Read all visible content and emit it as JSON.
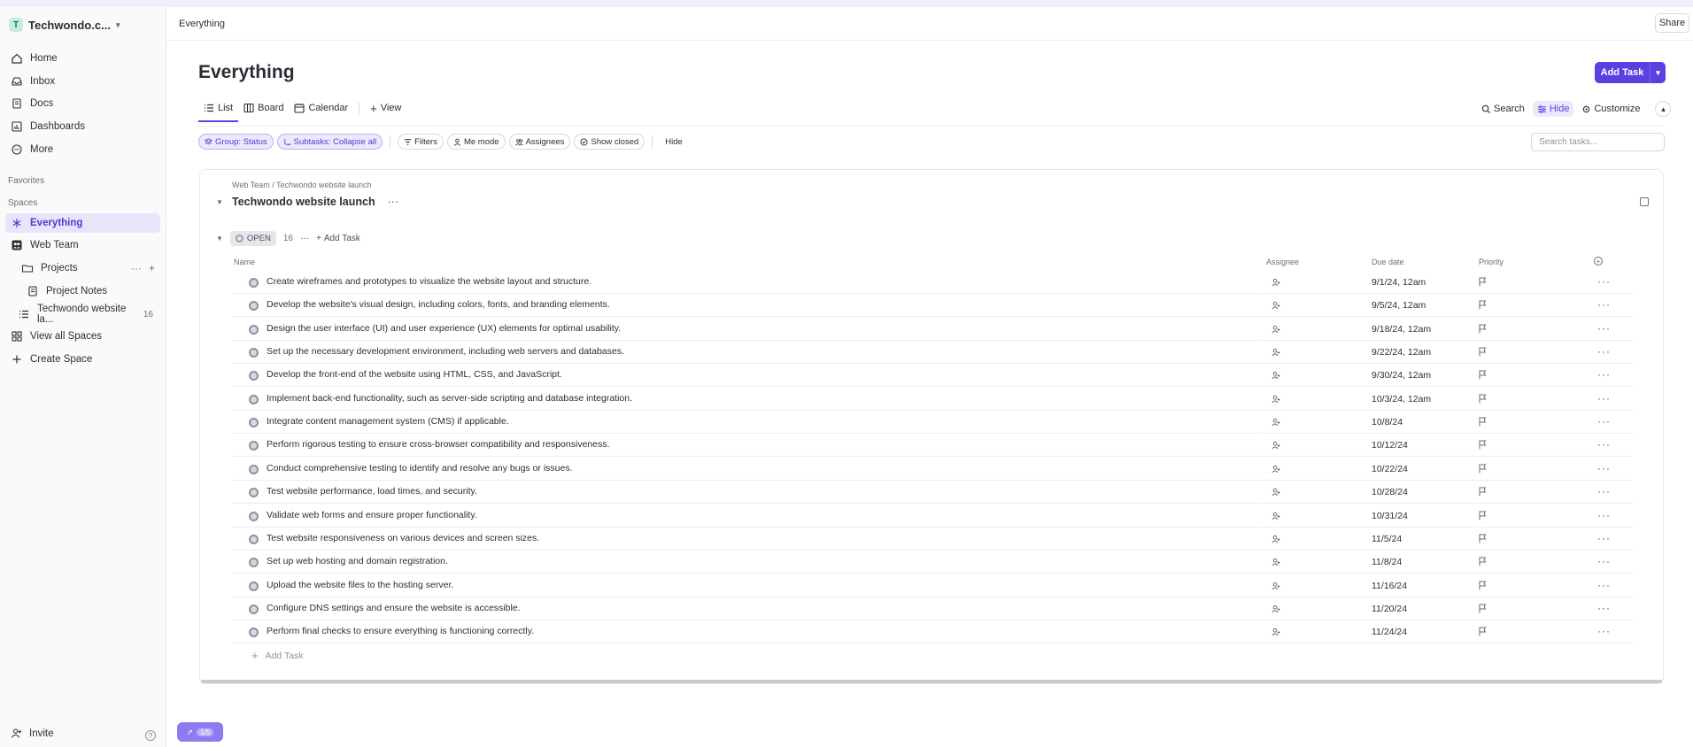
{
  "workspace": {
    "avatar_letter": "T",
    "name": "Techwondo.c..."
  },
  "nav": {
    "home": "Home",
    "inbox": "Inbox",
    "docs": "Docs",
    "dashboards": "Dashboards",
    "more": "More"
  },
  "sidebar": {
    "favorites_label": "Favorites",
    "spaces_label": "Spaces",
    "everything": "Everything",
    "web_team": "Web Team",
    "projects": "Projects",
    "project_notes": "Project Notes",
    "list_name": "Techwondo website la...",
    "list_count": "16",
    "view_all_spaces": "View all Spaces",
    "create_space": "Create Space",
    "invite": "Invite"
  },
  "header": {
    "breadcrumb": "Everything",
    "share_label": "Share",
    "page_title": "Everything",
    "add_task_label": "Add Task"
  },
  "tabs": {
    "list": "List",
    "board": "Board",
    "calendar": "Calendar",
    "add_view": "View"
  },
  "tools": {
    "search": "Search",
    "hide": "Hide",
    "customize": "Customize"
  },
  "chips": {
    "group_status": "Group: Status",
    "subtasks": "Subtasks: Collapse all",
    "filters": "Filters",
    "me_mode": "Me mode",
    "assignees": "Assignees",
    "show_closed": "Show closed",
    "hide": "Hide"
  },
  "search_tasks_placeholder": "Search tasks...",
  "list": {
    "breadcrumb": "Web Team / Techwondo website launch",
    "title": "Techwondo website launch",
    "group": {
      "status": "OPEN",
      "count": "16",
      "add_task": "Add Task"
    },
    "columns": {
      "name": "Name",
      "assignee": "Assignee",
      "due_date": "Due date",
      "priority": "Priority"
    },
    "tasks": [
      {
        "name": "Create wireframes and prototypes to visualize the website layout and structure.",
        "due": "9/1/24, 12am"
      },
      {
        "name": "Develop the website's visual design, including colors, fonts, and branding elements.",
        "due": "9/5/24, 12am"
      },
      {
        "name": "Design the user interface (UI) and user experience (UX) elements for optimal usability.",
        "due": "9/18/24, 12am"
      },
      {
        "name": "Set up the necessary development environment, including web servers and databases.",
        "due": "9/22/24, 12am"
      },
      {
        "name": "Develop the front-end of the website using HTML, CSS, and JavaScript.",
        "due": "9/30/24, 12am"
      },
      {
        "name": "Implement back-end functionality, such as server-side scripting and database integration.",
        "due": "10/3/24, 12am"
      },
      {
        "name": "Integrate content management system (CMS) if applicable.",
        "due": "10/8/24"
      },
      {
        "name": "Perform rigorous testing to ensure cross-browser compatibility and responsiveness.",
        "due": "10/12/24"
      },
      {
        "name": "Conduct comprehensive testing to identify and resolve any bugs or issues.",
        "due": "10/22/24"
      },
      {
        "name": "Test website performance, load times, and security.",
        "due": "10/28/24"
      },
      {
        "name": "Validate web forms and ensure proper functionality.",
        "due": "10/31/24"
      },
      {
        "name": "Test website responsiveness on various devices and screen sizes.",
        "due": "11/5/24"
      },
      {
        "name": "Set up web hosting and domain registration.",
        "due": "11/8/24"
      },
      {
        "name": "Upload the website files to the hosting server.",
        "due": "11/16/24"
      },
      {
        "name": "Configure DNS settings and ensure the website is accessible.",
        "due": "11/20/24"
      },
      {
        "name": "Perform final checks to ensure everything is functioning correctly.",
        "due": "11/24/24"
      }
    ],
    "add_task_row": "Add Task"
  },
  "rocket_badge": "1/5",
  "colors": {
    "accent": "#5b3fe0",
    "active_nav_bg": "#e8e5fb"
  }
}
